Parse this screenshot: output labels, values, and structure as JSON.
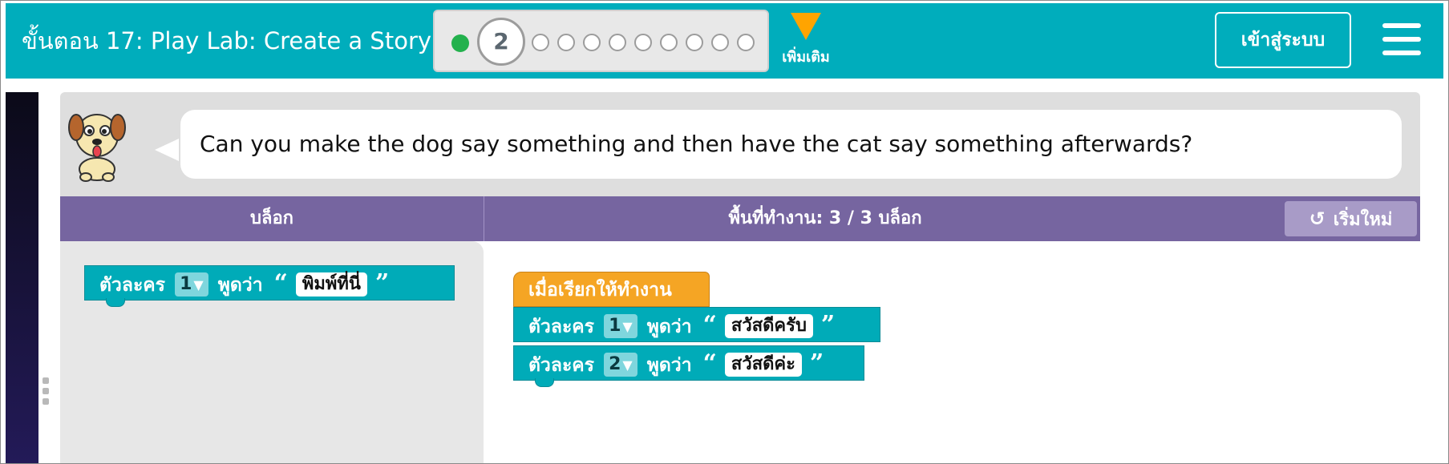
{
  "header": {
    "title": "ขั้นตอน 17: Play Lab: Create a Story",
    "progress": {
      "current_step": "2"
    },
    "more_label": "เพิ่มเติม",
    "signin_label": "เข้าสู่ระบบ"
  },
  "instructions": {
    "text": "Can you make the dog say something and then have the cat say something afterwards?"
  },
  "toolbar": {
    "blocks_label": "บล็อก",
    "workspace_label": "พื้นที่ทำงาน: 3 / 3 บล็อก",
    "reset_label": "เริ่มใหม่"
  },
  "toolbox": {
    "say_block": {
      "prefix": "ตัวละคร",
      "actor": "1",
      "verb": "พูดว่า",
      "open_quote": "“",
      "text": "พิมพ์ที่นี่",
      "close_quote": "”"
    }
  },
  "workspace": {
    "when_run_label": "เมื่อเรียกให้ทำงาน",
    "blocks": [
      {
        "prefix": "ตัวละคร",
        "actor": "1",
        "verb": "พูดว่า",
        "open_quote": "“",
        "text": "สวัสดีครับ",
        "close_quote": "”"
      },
      {
        "prefix": "ตัวละคร",
        "actor": "2",
        "verb": "พูดว่า",
        "open_quote": "“",
        "text": "สวัสดีค่ะ",
        "close_quote": "”"
      }
    ]
  },
  "colors": {
    "header": "#00adbc",
    "purple_bar": "#7665a0",
    "block_teal": "#00abb8",
    "block_orange": "#f5a524",
    "progress_done": "#23b14d"
  },
  "icons": {
    "more": "triangle-down-icon",
    "menu": "hamburger-icon",
    "reset": "rotate-ccw-icon",
    "dropdown": "caret-down-icon"
  }
}
